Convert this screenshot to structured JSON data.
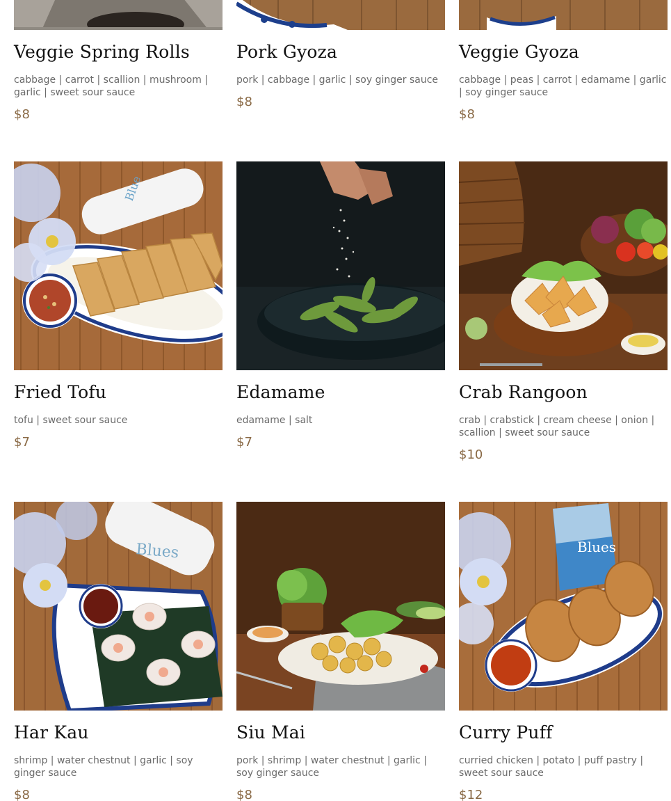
{
  "colors": {
    "title": "#111111",
    "description": "#6b6b6b",
    "price": "#8a6a46",
    "background": "#ffffff"
  },
  "menu": {
    "items": [
      {
        "name": "Veggie Spring Rolls",
        "description": "cabbage | carrot | scallion | mushroom | garlic | sweet sour sauce",
        "price": "$8",
        "image_icon": "spring-rolls-photo"
      },
      {
        "name": "Pork Gyoza",
        "description": "pork | cabbage | garlic | soy ginger sauce",
        "price": "$8",
        "image_icon": "pork-gyoza-photo"
      },
      {
        "name": "Veggie Gyoza",
        "description": "cabbage | peas | carrot | edamame | garlic | soy ginger sauce",
        "price": "$8",
        "image_icon": "veggie-gyoza-photo"
      },
      {
        "name": "Fried Tofu",
        "description": "tofu | sweet sour sauce",
        "price": "$7",
        "image_icon": "fried-tofu-photo"
      },
      {
        "name": "Edamame",
        "description": "edamame | salt",
        "price": "$7",
        "image_icon": "edamame-photo"
      },
      {
        "name": "Crab Rangoon",
        "description": "crab | crabstick | cream cheese | onion | scallion | sweet sour sauce",
        "price": "$10",
        "image_icon": "crab-rangoon-photo"
      },
      {
        "name": "Har Kau",
        "description": "shrimp | water chestnut | garlic | soy ginger sauce",
        "price": "$8",
        "image_icon": "har-kau-photo"
      },
      {
        "name": "Siu Mai",
        "description": "pork | shrimp | water chestnut | garlic | soy ginger sauce",
        "price": "$8",
        "image_icon": "siu-mai-photo"
      },
      {
        "name": "Curry Puff",
        "description": "curried chicken | potato | puff pastry | sweet sour sauce",
        "price": "$12",
        "image_icon": "curry-puff-photo"
      }
    ]
  }
}
